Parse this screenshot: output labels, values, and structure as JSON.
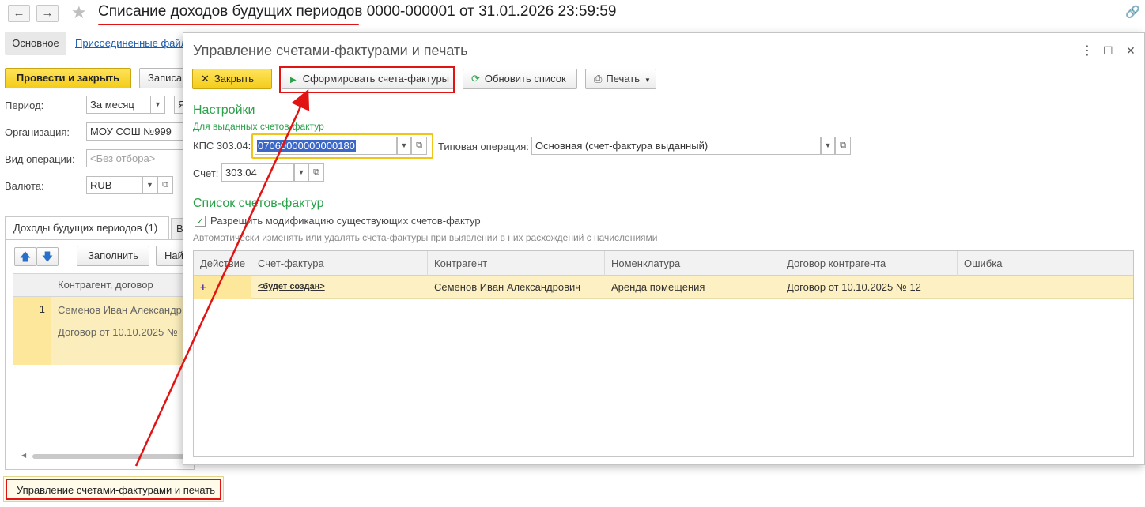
{
  "base": {
    "title": "Списание доходов будущих периодов 0000-000001 от 31.01.2026 23:59:59",
    "nav_back": "←",
    "nav_forward": "→",
    "star": "★",
    "link_icon": "🔗",
    "tabs": {
      "main": "Основное",
      "files": "Присоединенные файл"
    },
    "buttons": {
      "post_close": "Провести и закрыть",
      "write": "Записа"
    },
    "fields": {
      "period_label": "Период:",
      "period_value": "За месяц",
      "period_extra": "Я",
      "org_label": "Организация:",
      "org_value": "МОУ СОШ №999",
      "optype_label": "Вид операции:",
      "optype_placeholder": "<Без отбора>",
      "currency_label": "Валюта:",
      "currency_value": "RUB"
    },
    "bottom_tabs": {
      "active": "Доходы будущих периодов (1)",
      "next": "В"
    },
    "list": {
      "up_icon": "🡅",
      "down_icon": "🡇",
      "fill_button": "Заполнить",
      "find_button": "Най",
      "header": "Контрагент, договор",
      "row_num": "1",
      "row_line1": "Семенов Иван Александр",
      "row_line2": "Договор от 10.10.2025 №"
    },
    "taskbar_label": "Управление счетами-фактурами и печать"
  },
  "dialog": {
    "title": "Управление счетами-фактурами и печать",
    "menu_icon": "⋮",
    "maximize_icon": "☐",
    "close_icon": "✕",
    "toolbar": {
      "close": "Закрыть",
      "generate": "Сформировать счета-фактуры",
      "refresh": "Обновить список",
      "print": "Печать"
    },
    "settings": {
      "header": "Настройки",
      "sub": "Для выданных счетов-фактур",
      "kps_label": "КПС 303.04:",
      "kps_value": "07060000000000180",
      "typical_op_label": "Типовая операция:",
      "typical_op_value": "Основная (счет-фактура выданный)",
      "account_label": "Счет:",
      "account_value": "303.04"
    },
    "list_section": {
      "header": "Список счетов-фактур",
      "allow_modify_label": "Разрешить модификацию существующих счетов-фактур",
      "allow_modify_checked": true,
      "note": "Автоматически изменять или удалять счета-фактуры при выявлении в них расхождений с начислениями"
    },
    "grid": {
      "columns": [
        "Действие",
        "Счет-фактура",
        "Контрагент",
        "Номенклатура",
        "Договор контрагента",
        "Ошибка"
      ],
      "rows": [
        {
          "action": "+",
          "invoice": "<будет создан>",
          "counterparty": "Семенов Иван Александрович",
          "nomenclature": "Аренда помещения",
          "contract": "Договор от 10.10.2025 № 12",
          "error": ""
        }
      ]
    }
  },
  "colors": {
    "accent_yellow": "#f3cc19",
    "highlight_red": "#e21313",
    "section_green": "#2aa14a",
    "row_highlight": "#fdf0c2"
  }
}
